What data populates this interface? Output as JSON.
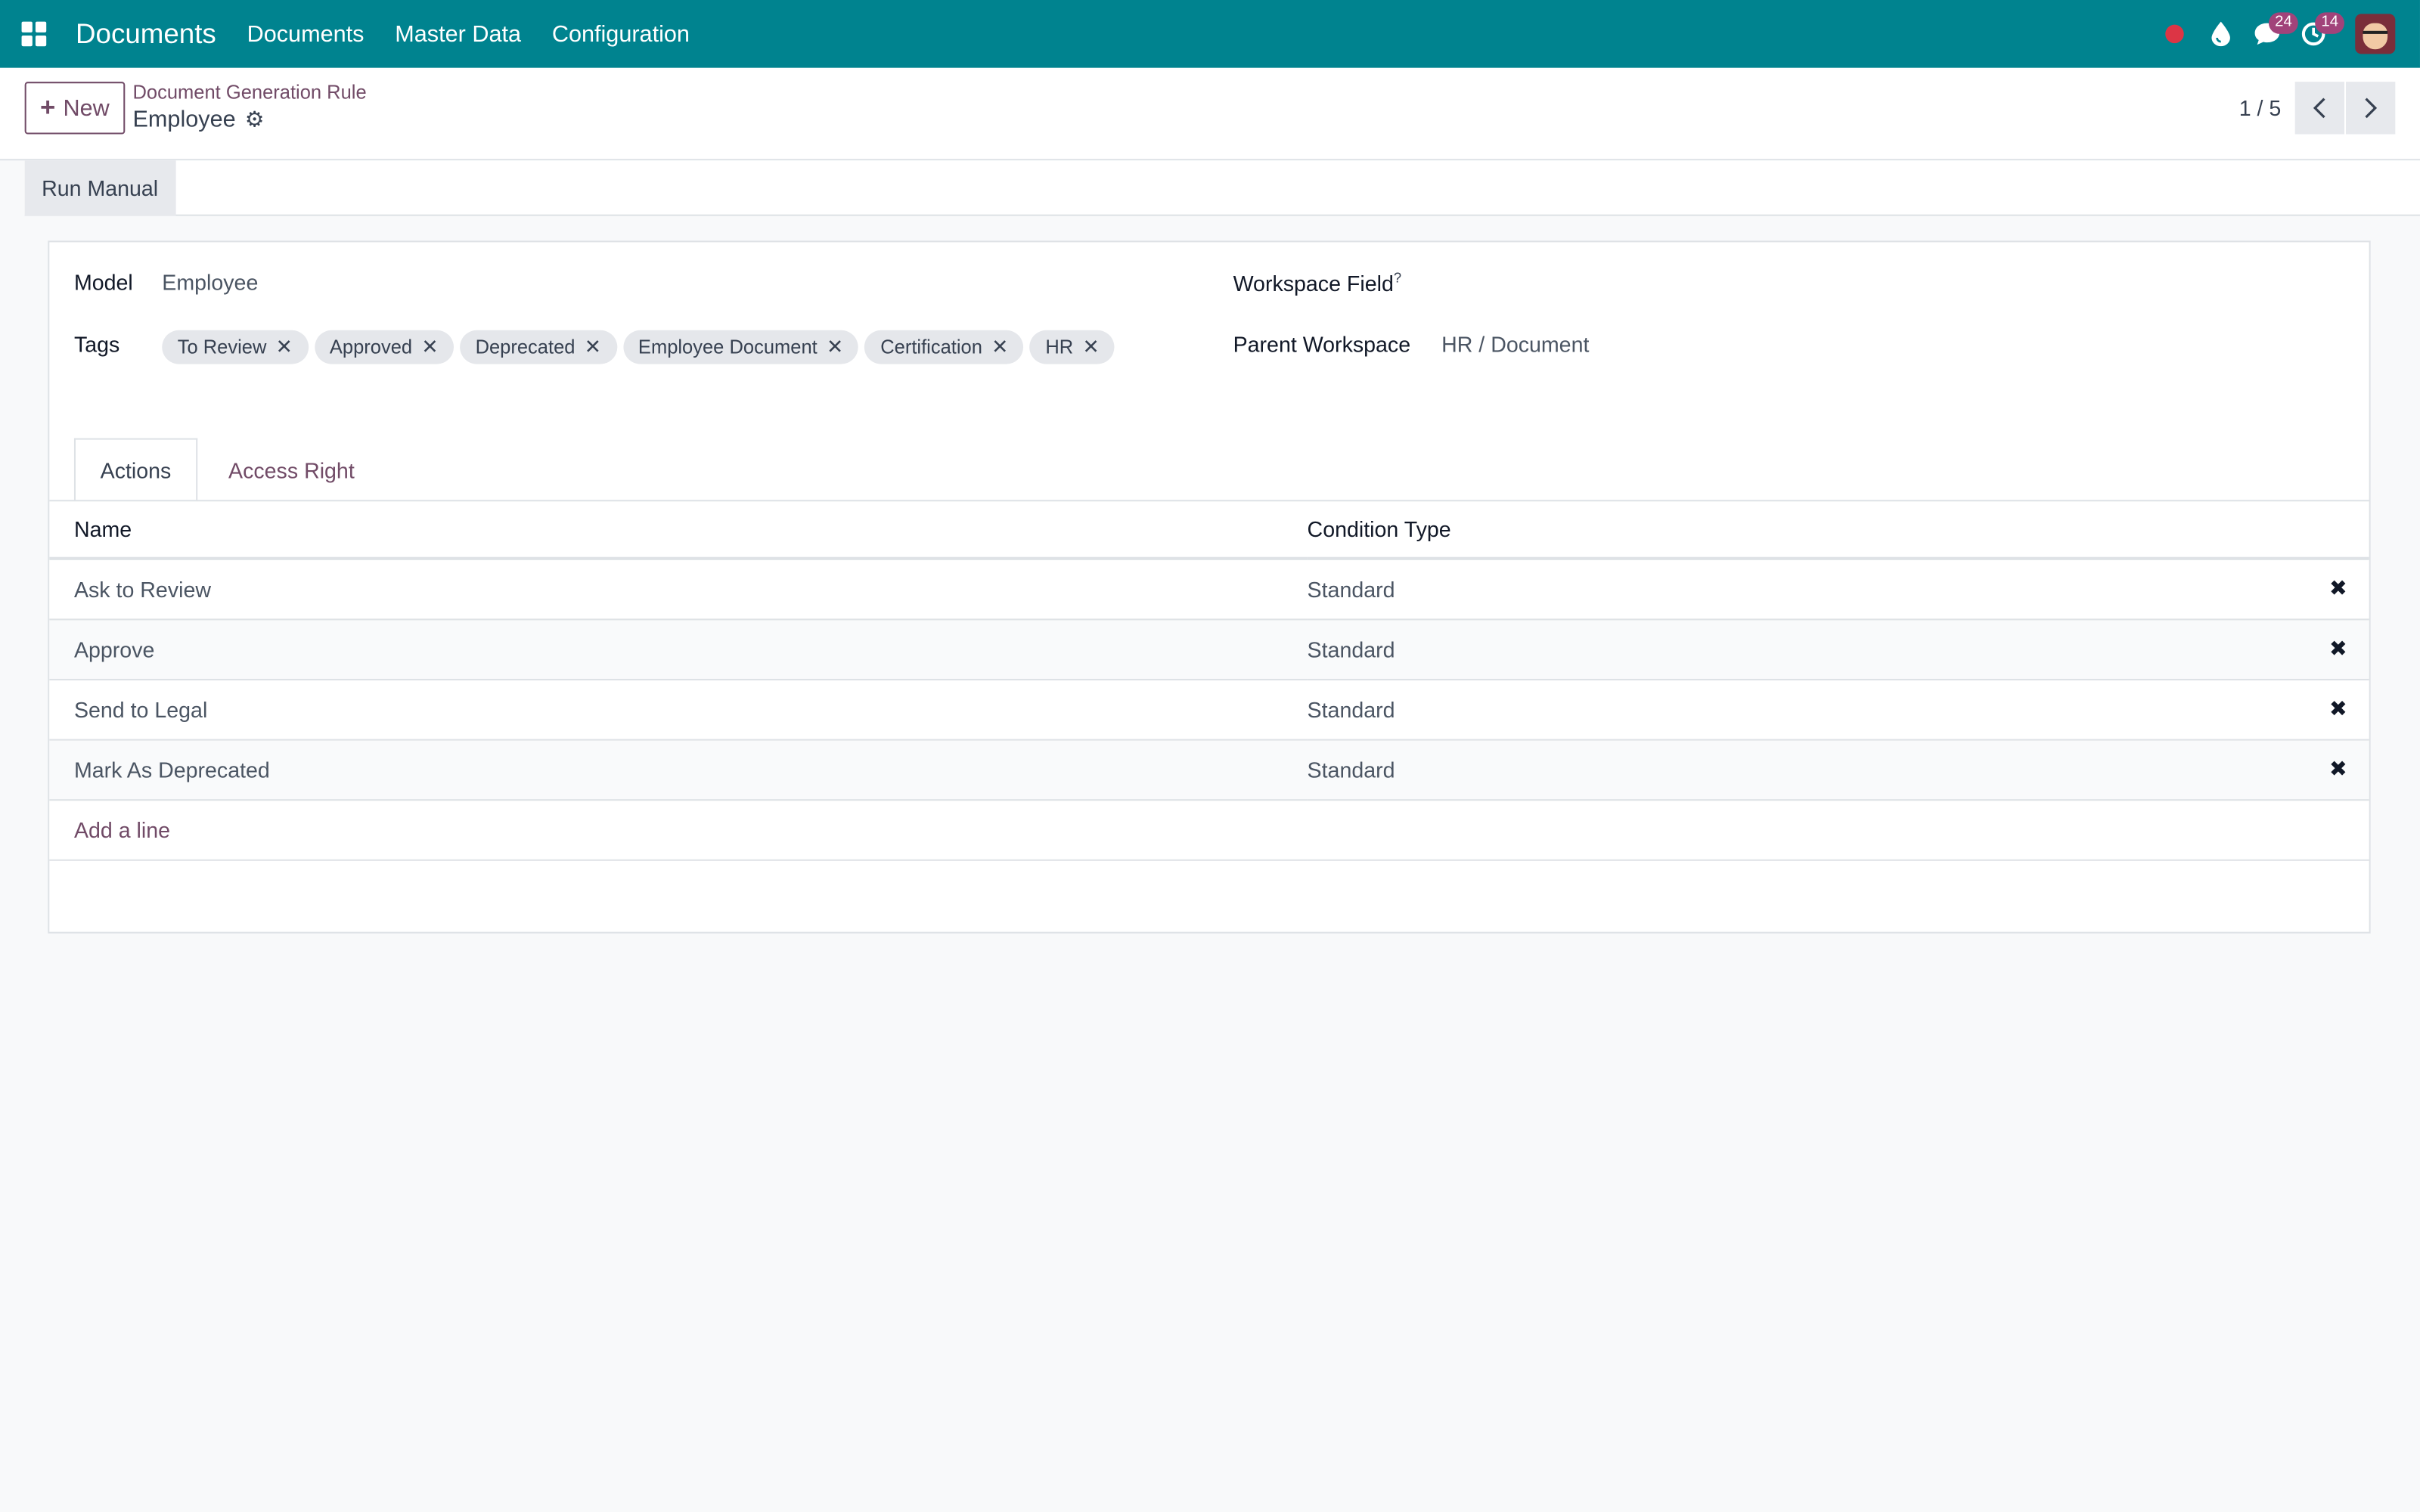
{
  "topbar": {
    "app_title": "Documents",
    "menu": [
      "Documents",
      "Master Data",
      "Configuration"
    ],
    "messages_count": "24",
    "activities_count": "14"
  },
  "control": {
    "new_label": "New",
    "breadcrumb": "Document Generation Rule",
    "record_title": "Employee",
    "pager": "1 / 5"
  },
  "statusbar": {
    "run_manual_label": "Run Manual"
  },
  "form": {
    "model_label": "Model",
    "model_value": "Employee",
    "tags_label": "Tags",
    "tags": [
      "To Review",
      "Approved",
      "Deprecated",
      "Employee Document",
      "Certification",
      "HR"
    ],
    "workspace_field_label": "Workspace Field",
    "workspace_field_help": "?",
    "parent_workspace_label": "Parent Workspace",
    "parent_workspace_value": "HR / Document"
  },
  "tabs": [
    "Actions",
    "Access Right"
  ],
  "actions_table": {
    "columns": [
      "Name",
      "Condition Type"
    ],
    "rows": [
      {
        "name": "Ask to Review",
        "condition": "Standard"
      },
      {
        "name": "Approve",
        "condition": "Standard"
      },
      {
        "name": "Send to Legal",
        "condition": "Standard"
      },
      {
        "name": "Mark As Deprecated",
        "condition": "Standard"
      }
    ],
    "add_line_label": "Add a line"
  },
  "colors": {
    "topbar": "#00838f",
    "accent": "#714b67",
    "badge": "#a1437a"
  }
}
